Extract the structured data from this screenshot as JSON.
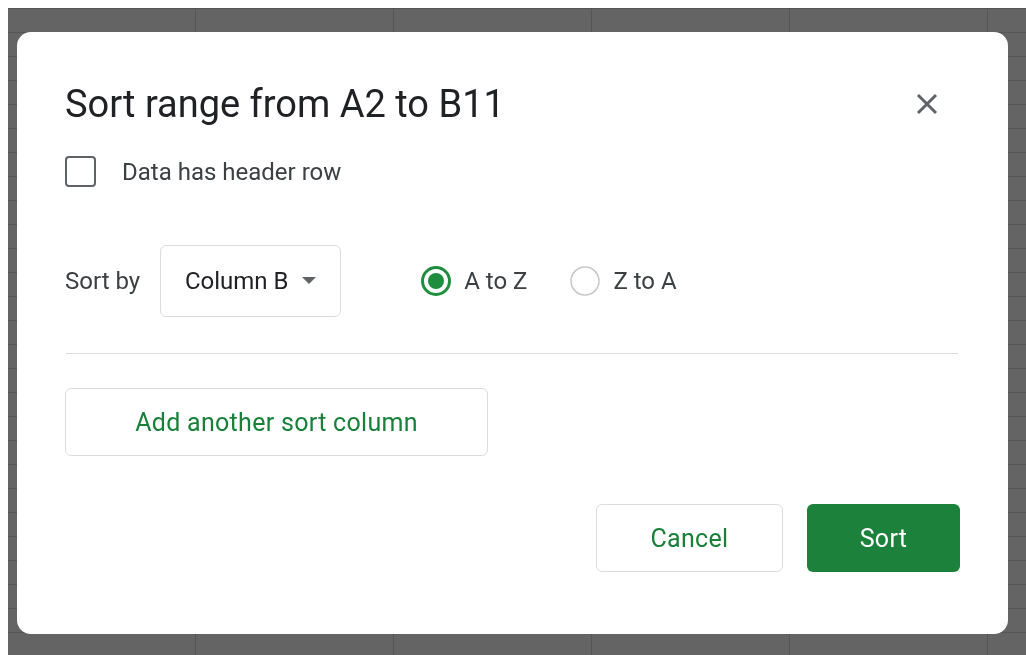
{
  "dialog": {
    "title": "Sort range from A2 to B11",
    "header_row": {
      "label": "Data has header row",
      "checked": false
    },
    "sort_by": {
      "label": "Sort by",
      "value": "Column B"
    },
    "order": [
      {
        "label": "A to Z",
        "selected": true
      },
      {
        "label": "Z to A",
        "selected": false
      }
    ],
    "add_button": "Add another sort column",
    "buttons": [
      {
        "label": "Cancel",
        "kind": "secondary"
      },
      {
        "label": "Sort",
        "kind": "primary"
      }
    ]
  }
}
